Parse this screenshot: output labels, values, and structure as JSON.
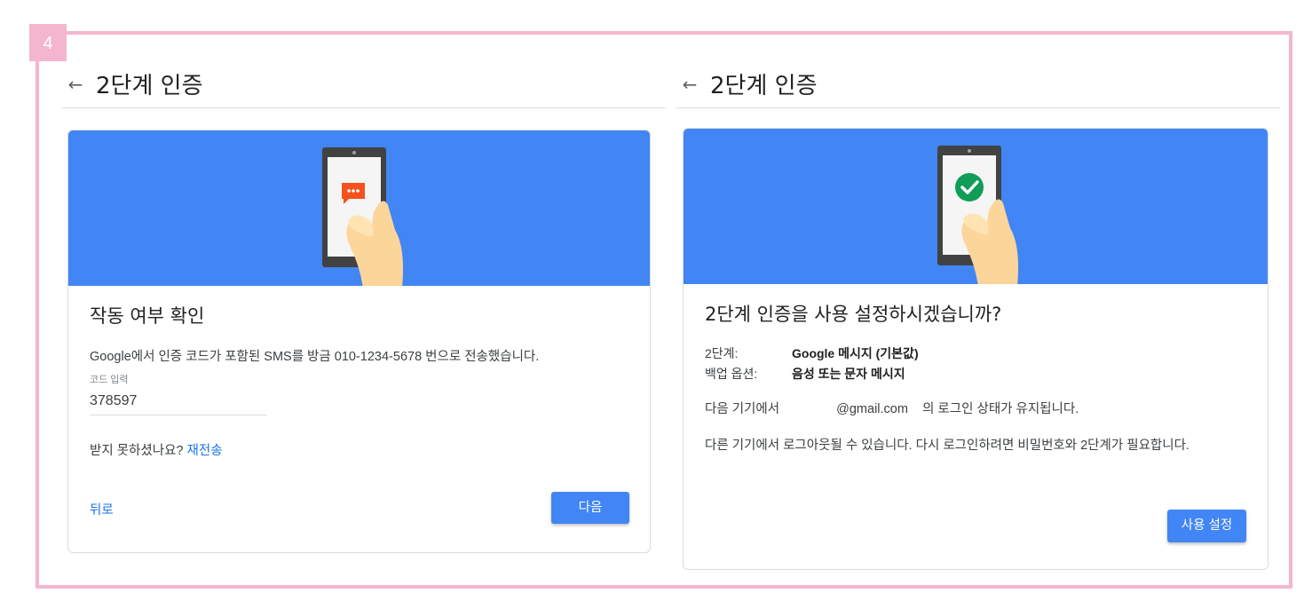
{
  "step_number": "4",
  "left_panel": {
    "header_title": "2단계 인증",
    "card": {
      "title": "작동 여부 확인",
      "description": "Google에서 인증 코드가 포함된 SMS를 방금 010-1234-5678 번으로 전송했습니다.",
      "code_input_label": "코드 입력",
      "code_value": "378597",
      "not_received_text": "받지 못하셨나요?",
      "resend_link": "재전송",
      "back_link": "뒤로",
      "next_button": "다음"
    }
  },
  "right_panel": {
    "header_title": "2단계 인증",
    "card": {
      "title": "2단계 인증을 사용 설정하시겠습니까?",
      "rows": [
        {
          "key": "2단계:",
          "value": "Google 메시지 (기본값)"
        },
        {
          "key": "백업 옵션:",
          "value": "음성 또는 문자 메시지"
        }
      ],
      "device_text_prefix": "다음 기기에서",
      "device_email": "@gmail.com",
      "device_text_suffix": "의 로그인 상태가 유지됩니다.",
      "logout_notice": "다른 기기에서 로그아웃될 수 있습니다. 다시 로그인하려면 비밀번호와 2단계가 필요합니다.",
      "enable_button": "사용 설정"
    }
  },
  "colors": {
    "frame_pink": "#f4b6cf",
    "banner_blue": "#4285f4",
    "link_blue": "#1a73e8",
    "chat_icon_orange": "#f4511e",
    "check_icon_green": "#0f9d58"
  },
  "icons": [
    "back-arrow-icon",
    "chat-bubble-icon",
    "checkmark-circle-icon",
    "hand-illustration"
  ]
}
